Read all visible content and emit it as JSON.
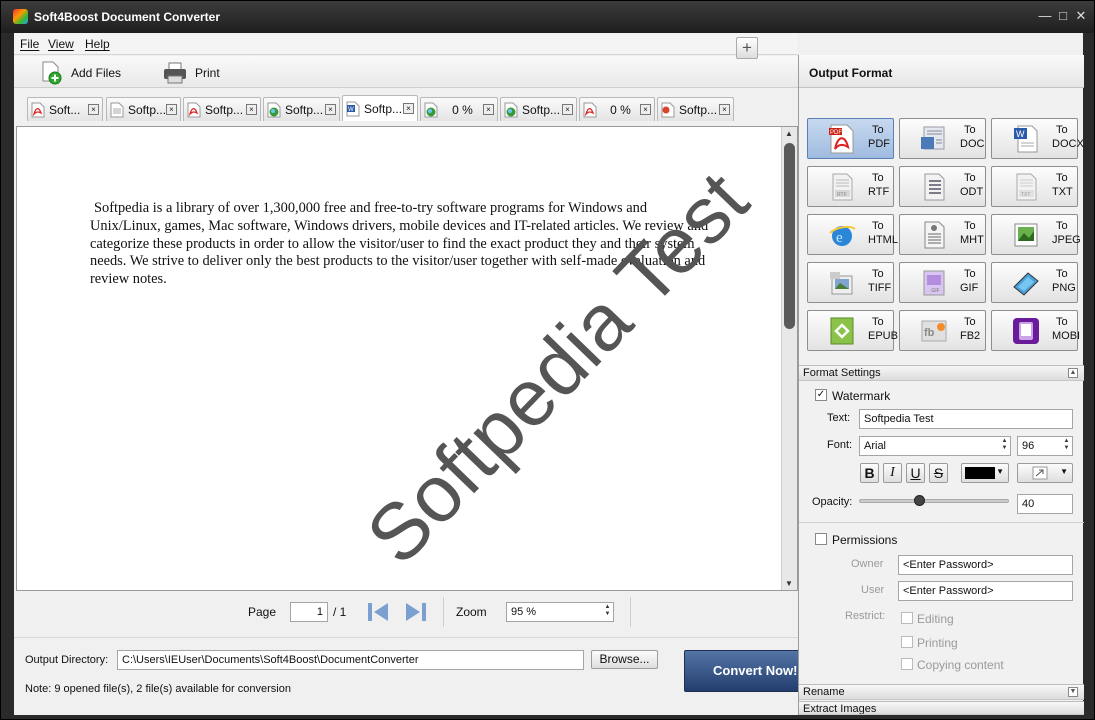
{
  "window": {
    "title": "Soft4Boost Document Converter",
    "controls": {
      "minimize": "—",
      "maximize": "□",
      "close": "✕"
    }
  },
  "menu": [
    "File",
    "View",
    "Help"
  ],
  "toolbar": {
    "add_files_label": "Add Files",
    "print_label": "Print"
  },
  "tabs": [
    {
      "label": "Soft...",
      "icon": "pdf-icon"
    },
    {
      "label": "Softp...",
      "icon": "text-file-icon"
    },
    {
      "label": "Softp...",
      "icon": "pdf-icon"
    },
    {
      "label": "Softp...",
      "icon": "globe-file-icon"
    },
    {
      "label": "Softp...",
      "icon": "word-file-icon",
      "active": true
    },
    {
      "label": "0 %",
      "icon": "globe-file-icon"
    },
    {
      "label": "Softp...",
      "icon": "globe-file-icon"
    },
    {
      "label": "0 %",
      "icon": "pdf-icon"
    },
    {
      "label": "Softp...",
      "icon": "powerpoint-file-icon"
    }
  ],
  "document": {
    "text": "Softpedia is a library of over 1,300,000 free and free-to-try software programs for Windows and Unix/Linux, games, Mac software, Windows drivers, mobile devices and IT-related articles. We review and categorize these products in order to allow the visitor/user to find the exact product they and their system needs. We strive to deliver only the best products to the visitor/user together with self-made evaluation and review notes.",
    "watermark_preview": "Softpedia Test"
  },
  "pager": {
    "page_label": "Page",
    "page_value": "1",
    "page_total": "/ 1",
    "zoom_label": "Zoom",
    "zoom_value": "95 %"
  },
  "output": {
    "dir_label": "Output Directory:",
    "dir_value": "C:\\Users\\IEUser\\Documents\\Soft4Boost\\DocumentConverter",
    "browse_label": "Browse...",
    "note": "Note: 9 opened file(s), 2 file(s) available for conversion",
    "convert_label": "Convert Now!"
  },
  "right_panel": {
    "header": "Output Format",
    "to_label": "To",
    "formats": [
      "PDF",
      "DOC",
      "DOCX",
      "RTF",
      "ODT",
      "TXT",
      "HTML",
      "MHT",
      "JPEG",
      "TIFF",
      "GIF",
      "PNG",
      "EPUB",
      "FB2",
      "MOBI"
    ],
    "selected_format": "PDF",
    "format_settings": {
      "title": "Format Settings",
      "watermark_label": "Watermark",
      "watermark_checked": true,
      "text_label": "Text:",
      "text_value": "Softpedia Test",
      "font_label": "Font:",
      "font_value": "Arial",
      "size_value": "96",
      "style_buttons": [
        "B",
        "I",
        "U",
        "S"
      ],
      "color_value": "#000000",
      "opacity_label": "Opacity:",
      "opacity_value": "40",
      "opacity_fraction": 0.4
    },
    "permissions": {
      "label": "Permissions",
      "owner_label": "Owner",
      "owner_placeholder": "<Enter Password>",
      "user_label": "User",
      "user_placeholder": "<Enter Password>",
      "restrict_label": "Restrict:",
      "options": [
        "Editing",
        "Printing",
        "Copying content"
      ]
    },
    "rename_label": "Rename",
    "extract_label": "Extract Images"
  }
}
